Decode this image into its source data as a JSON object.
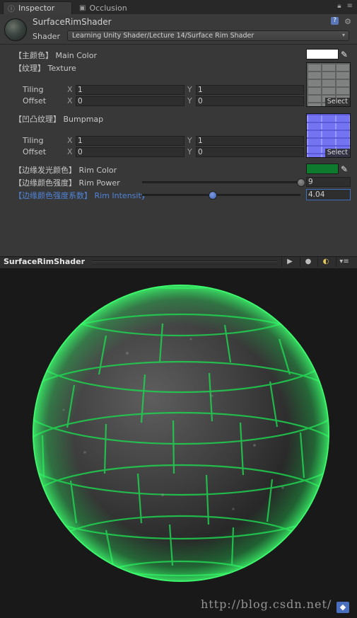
{
  "tabs": [
    {
      "label": "Inspector",
      "icon": "info-icon",
      "active": true
    },
    {
      "label": "Occlusion",
      "icon": "window-icon",
      "active": false
    }
  ],
  "material": {
    "name": "SurfaceRimShader",
    "shader_label": "Shader",
    "shader_value": "Learning Unity Shader/Lecture 14/Surface Rim Shader"
  },
  "properties": {
    "main_color": {
      "label": "【主颜色】 Main Color",
      "color": "#ffffff"
    },
    "texture": {
      "label": "【纹理】 Texture",
      "tiling_label": "Tiling",
      "offset_label": "Offset",
      "tiling_x": "1",
      "tiling_y": "1",
      "offset_x": "0",
      "offset_y": "0",
      "select_label": "Select"
    },
    "bumpmap": {
      "label": "【凹凸纹理】 Bumpmap",
      "tiling_label": "Tiling",
      "offset_label": "Offset",
      "tiling_x": "1",
      "tiling_y": "1",
      "offset_x": "0",
      "offset_y": "0",
      "select_label": "Select"
    },
    "axis_x": "X",
    "axis_y": "Y",
    "rim_color": {
      "label": "【边缘发光颜色】 Rim Color",
      "color": "#0e7a2e"
    },
    "rim_power": {
      "label": "【边缘颜色强度】 Rim Power",
      "value": "9",
      "fraction": 1.0
    },
    "rim_intensity": {
      "label": "【边缘颜色强度系数】 Rim Intensity",
      "value": "4.04",
      "fraction": 0.44
    }
  },
  "preview": {
    "title": "SurfaceRimShader",
    "watermark": "http://blog.csdn.net/",
    "rim_glow": "#27e05a"
  }
}
